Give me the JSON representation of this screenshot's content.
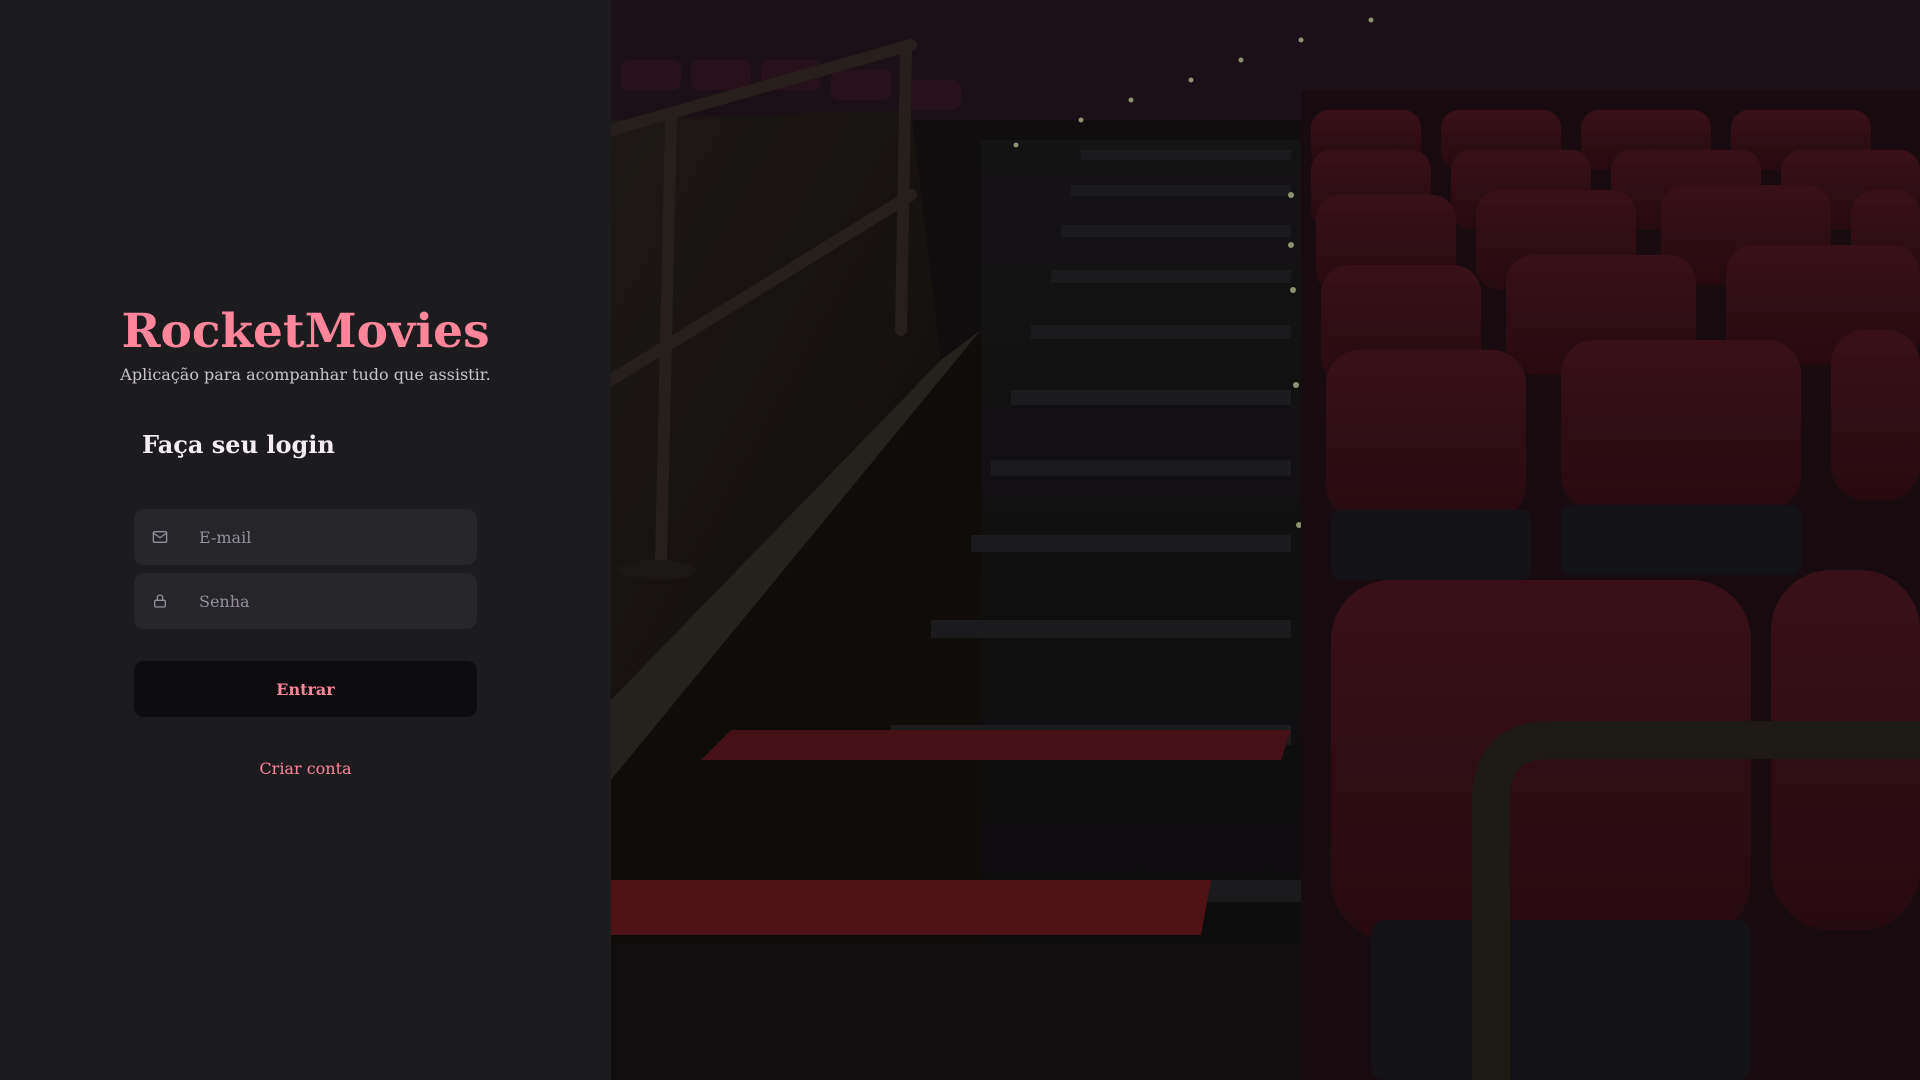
{
  "brand": {
    "title": "RocketMovies",
    "subtitle": "Aplicação para acompanhar tudo que assistir."
  },
  "login": {
    "heading": "Faça seu login",
    "email_placeholder": "E-mail",
    "password_placeholder": "Senha",
    "submit_label": "Entrar",
    "create_account_label": "Criar conta"
  },
  "icons": {
    "email": "mail-icon",
    "password": "lock-icon"
  },
  "colors": {
    "accent": "#ff859b",
    "panel_background": "#1c1b1e",
    "input_background": "#262529",
    "button_background": "#0d0c0f",
    "placeholder": "#948f99"
  },
  "background_image": {
    "subject": "cinema-stairs-and-red-seats"
  }
}
